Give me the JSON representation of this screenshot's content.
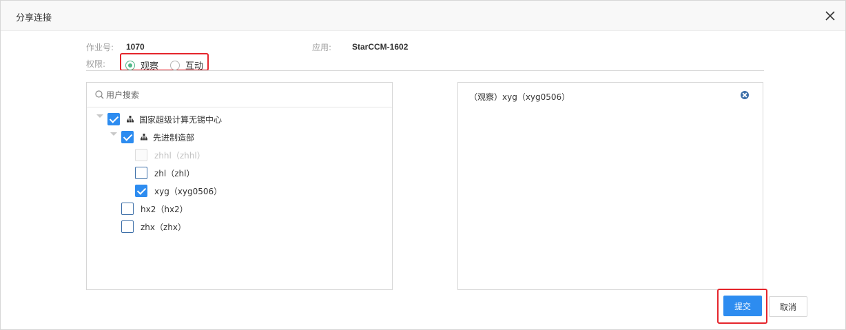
{
  "dialog": {
    "title": "分享连接",
    "job_label": "作业号:",
    "job_value": "1070",
    "app_label": "应用:",
    "app_value": "StarCCM-1602",
    "perm_label": "权限:",
    "perm_options": [
      {
        "label": "观察",
        "checked": true
      },
      {
        "label": "互动",
        "checked": false
      }
    ]
  },
  "search": {
    "placeholder": "用户搜索"
  },
  "tree": {
    "root": {
      "label": "国家超级计算无锡中心",
      "checked": true
    },
    "dept": {
      "label": "先进制造部",
      "checked": true
    },
    "users": [
      {
        "label": "zhhl（zhhl）",
        "checked": false,
        "disabled": true
      },
      {
        "label": "zhl（zhl）",
        "checked": false,
        "disabled": false
      },
      {
        "label": "xyg（xyg0506）",
        "checked": true,
        "disabled": false
      },
      {
        "label": "hx2（hx2）",
        "checked": false,
        "disabled": false
      },
      {
        "label": "zhx（zhx）",
        "checked": false,
        "disabled": false
      }
    ]
  },
  "selected": [
    {
      "label": "（观察）xyg（xyg0506）"
    }
  ],
  "buttons": {
    "submit": "提交",
    "cancel": "取消"
  },
  "colors": {
    "accent": "#2d8cf0",
    "highlight": "#e5242b",
    "radio_on": "#52b788"
  }
}
